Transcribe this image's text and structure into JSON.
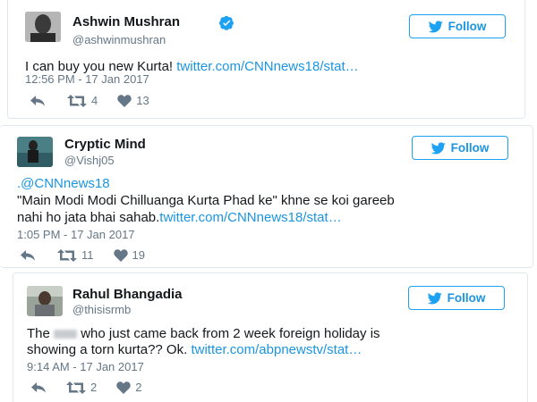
{
  "colors": {
    "link": "#1b95e0",
    "muted": "#657786",
    "border": "#e1e8ed",
    "text": "#14171a"
  },
  "tweets": [
    {
      "name": "Ashwin Mushran",
      "handle": "@ashwinmushran",
      "verified": true,
      "follow_label": "Follow",
      "text_lines": [
        {
          "text": "I can buy you new Kurta! ",
          "link": "twitter.com/CNNnews18/stat…"
        }
      ],
      "timestamp": "12:56 PM - 17 Jan 2017",
      "retweets": "4",
      "likes": "13"
    },
    {
      "name": "Cryptic Mind",
      "handle": "@Vishj05",
      "verified": false,
      "follow_label": "Follow",
      "mention": ".@CNNnews18",
      "text_line1": "\"Main Modi Modi Chilluanga Kurta Phad ke\" khne se koi gareeb",
      "text_line2": "nahi ho jata bhai sahab.",
      "link": "twitter.com/CNNnews18/stat…",
      "timestamp": "1:05 PM - 17 Jan 2017",
      "retweets": "11",
      "likes": "19"
    },
    {
      "name": "Rahul Bhangadia",
      "handle": "@thisisrmb",
      "verified": false,
      "follow_label": "Follow",
      "text_line1_pre": "The",
      "text_line1_post": "who just came back from 2 week foreign holiday is",
      "text_line2": "showing a torn kurta?? Ok. ",
      "link": "twitter.com/abpnewstv/stat…",
      "timestamp": "9:14 AM - 17 Jan 2017",
      "retweets": "2",
      "likes": "2"
    }
  ]
}
